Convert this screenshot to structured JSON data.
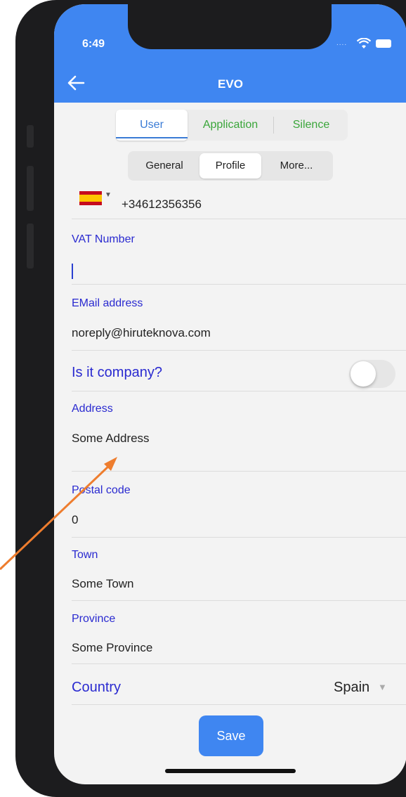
{
  "status_bar": {
    "time": "6:49",
    "signal_dots": "...."
  },
  "header": {
    "title": "EVO"
  },
  "tabs_primary": [
    {
      "label": "User",
      "active": true
    },
    {
      "label": "Application",
      "active": false
    },
    {
      "label": "Silence",
      "active": false
    }
  ],
  "tabs_secondary": [
    {
      "label": "General",
      "active": false
    },
    {
      "label": "Profile",
      "active": true
    },
    {
      "label": "More...",
      "active": false
    }
  ],
  "phone": {
    "country_flag": "spain-flag",
    "number": "+34612356356"
  },
  "fields": {
    "vat": {
      "label": "VAT Number",
      "value": ""
    },
    "email": {
      "label": "EMail address",
      "value": "noreply@hiruteknova.com"
    },
    "company": {
      "label": "Is it company?",
      "toggle_on": false
    },
    "address": {
      "label": "Address",
      "value": "Some Address"
    },
    "postal": {
      "label": "Postal code",
      "value": "0"
    },
    "town": {
      "label": "Town",
      "value": "Some Town"
    },
    "province": {
      "label": "Province",
      "value": "Some Province"
    },
    "country": {
      "label": "Country",
      "value": "Spain"
    }
  },
  "actions": {
    "save_label": "Save"
  },
  "colors": {
    "accent": "#3f86f1",
    "field_label": "#2a2ad0",
    "tab_inactive": "#3aa63a",
    "annotation_arrow": "#ee7d2e"
  },
  "icons": {
    "back": "arrow-left-icon",
    "wifi": "wifi-icon",
    "battery": "battery-icon",
    "dropdown": "caret-down-icon"
  }
}
